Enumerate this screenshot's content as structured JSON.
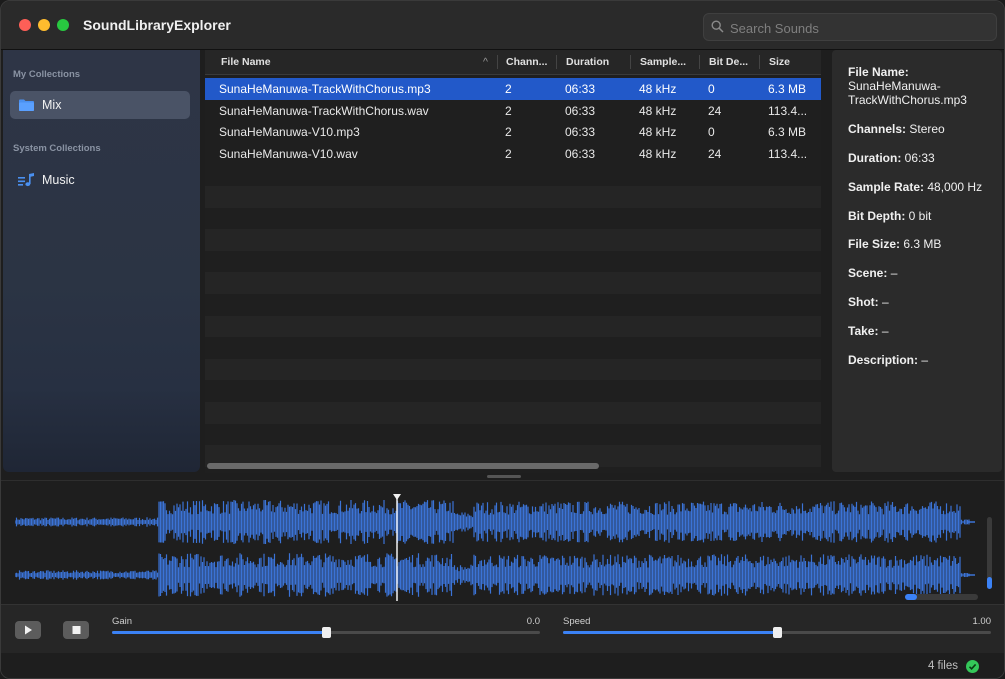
{
  "app": {
    "title": "SoundLibraryExplorer"
  },
  "search": {
    "placeholder": "Search Sounds"
  },
  "sidebar": {
    "sections": [
      {
        "heading": "My Collections",
        "items": [
          {
            "label": "Mix",
            "icon": "folder-icon",
            "selected": true
          }
        ]
      },
      {
        "heading": "System Collections",
        "items": [
          {
            "label": "Music",
            "icon": "music-note-list-icon",
            "selected": false
          }
        ]
      }
    ]
  },
  "table": {
    "columns": [
      "File Name",
      "Chann...",
      "Duration",
      "Sample...",
      "Bit De...",
      "Size"
    ],
    "sort_indicator": "^",
    "rows": [
      {
        "file": "SunaHeManuwa-TrackWithChorus.mp3",
        "channels": "2",
        "duration": "06:33",
        "sample": "48 kHz",
        "bit": "0",
        "size": "6.3 MB",
        "selected": true
      },
      {
        "file": "SunaHeManuwa-TrackWithChorus.wav",
        "channels": "2",
        "duration": "06:33",
        "sample": "48 kHz",
        "bit": "24",
        "size": "113.4...",
        "selected": false
      },
      {
        "file": "SunaHeManuwa-V10.mp3",
        "channels": "2",
        "duration": "06:33",
        "sample": "48 kHz",
        "bit": "0",
        "size": "6.3 MB",
        "selected": false
      },
      {
        "file": "SunaHeManuwa-V10.wav",
        "channels": "2",
        "duration": "06:33",
        "sample": "48 kHz",
        "bit": "24",
        "size": "113.4...",
        "selected": false
      }
    ]
  },
  "inspector": {
    "file_name_label": "File Name:",
    "file_name_line1": "SunaHeManuwa-",
    "file_name_line2": "TrackWithChorus.mp3",
    "channels_label": "Channels:",
    "channels_value": "Stereo",
    "duration_label": "Duration:",
    "duration_value": "06:33",
    "sample_rate_label": "Sample Rate:",
    "sample_rate_value": "48,000 Hz",
    "bit_depth_label": "Bit Depth:",
    "bit_depth_value": "0 bit",
    "file_size_label": "File Size:",
    "file_size_value": "6.3 MB",
    "scene_label": "Scene:",
    "scene_value": "–",
    "shot_label": "Shot:",
    "shot_value": "–",
    "take_label": "Take:",
    "take_value": "–",
    "description_label": "Description:",
    "description_value": "–"
  },
  "waveform": {
    "playhead_fraction": 0.4,
    "accent": "#3b73d6"
  },
  "controls": {
    "play_icon": "play-icon",
    "stop_icon": "stop-icon",
    "gain": {
      "label": "Gain",
      "value": "0.0",
      "level": 0.5
    },
    "speed": {
      "label": "Speed",
      "value": "1.00",
      "level": 0.5
    }
  },
  "status": {
    "text": "4 files"
  },
  "colors": {
    "selection": "#2259c9",
    "accent": "#3b82f6",
    "ok": "#34c759"
  }
}
